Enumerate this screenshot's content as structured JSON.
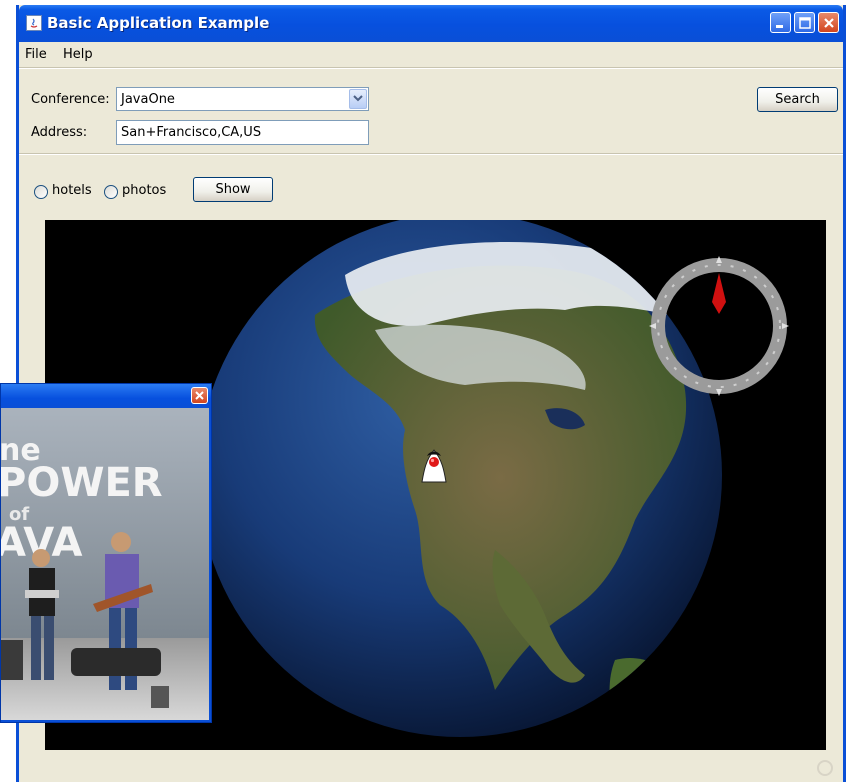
{
  "window": {
    "title": "Basic Application Example"
  },
  "menu": {
    "items": [
      {
        "label": "File"
      },
      {
        "label": "Help"
      }
    ]
  },
  "form": {
    "conference_label": "Conference:",
    "conference_value": "JavaOne",
    "address_label": "Address:",
    "address_value": "San+Francisco,CA,US",
    "search_label": "Search"
  },
  "options": {
    "hotels_label": "hotels",
    "photos_label": "photos",
    "hotels_selected": false,
    "photos_selected": false,
    "show_label": "Show"
  },
  "map": {
    "marker_location": "San Francisco",
    "compass_icon": "compass-icon"
  },
  "photo_window": {
    "banner_text_1": "ne",
    "banner_text_2": "POWER",
    "banner_text_3": "of",
    "banner_text_4": "AVA"
  },
  "colors": {
    "titlebar": "#0a4fd6",
    "window_bg": "#ece9d8",
    "compass_needle": "#d01010"
  }
}
